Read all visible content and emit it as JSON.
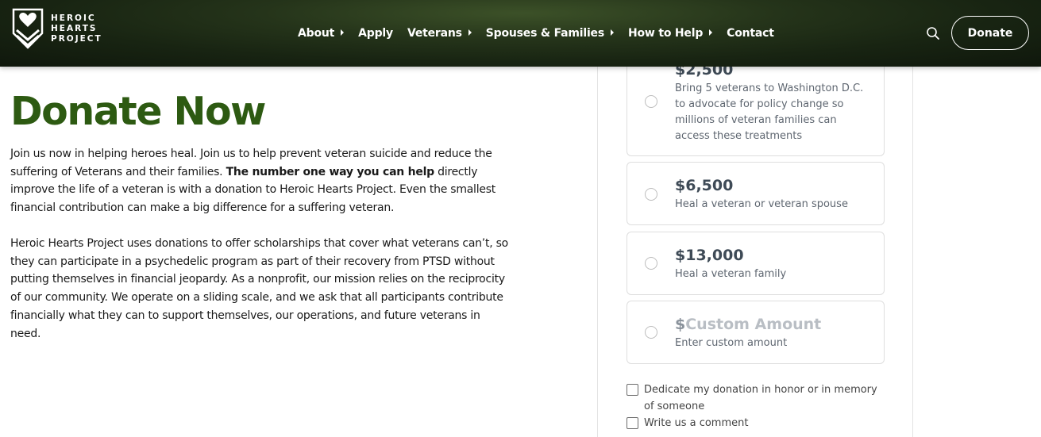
{
  "header": {
    "logo_lines": [
      "HEROIC",
      "HEARTS",
      "PROJECT"
    ],
    "nav": [
      {
        "label": "About",
        "has_submenu": true
      },
      {
        "label": "Apply",
        "has_submenu": false
      },
      {
        "label": "Veterans",
        "has_submenu": true
      },
      {
        "label": "Spouses & Families",
        "has_submenu": true
      },
      {
        "label": "How to Help",
        "has_submenu": true
      },
      {
        "label": "Contact",
        "has_submenu": false
      }
    ],
    "search_icon": "search-icon",
    "donate_label": "Donate"
  },
  "main": {
    "title": "Donate Now",
    "paragraph1_a": "Join us now in helping heroes heal. Join us to help prevent veteran suicide and reduce the suffering of Veterans and their families. ",
    "paragraph1_bold": "The number one way you can help",
    "paragraph1_b": " directly improve the life of a veteran is with a donation to Heroic Hearts Project. Even the smallest financial contribution can make a big difference for a suffering veteran.",
    "paragraph2": "Heroic Hearts Project uses donations to offer scholarships that cover what veterans can’t, so they can participate in a psychedelic program as part of their recovery from PTSD without putting themselves in financial jeopardy. As a nonprofit, our mission relies on the reciprocity of our community. We operate on a sliding scale, and we ask that all participants contribute financially what they can to support themselves, our operations, and future veterans in need."
  },
  "donation": {
    "options": [
      {
        "amount": "$2,500",
        "description": "Bring 5 veterans to Washington D.C. to advocate for policy change so millions of veteran families can access these treatments"
      },
      {
        "amount": "$6,500",
        "description": "Heal a veteran or veteran spouse"
      },
      {
        "amount": "$13,000",
        "description": "Heal a veteran family"
      }
    ],
    "custom": {
      "currency": "$",
      "placeholder": "Custom Amount",
      "description": "Enter custom amount"
    },
    "dedicate_label": "Dedicate my donation in honor or in memory of someone",
    "comment_label": "Write us a comment"
  },
  "colors": {
    "brand_green": "#2d5a12",
    "header_dark": "#182412",
    "amount_text": "#3e4a56"
  }
}
